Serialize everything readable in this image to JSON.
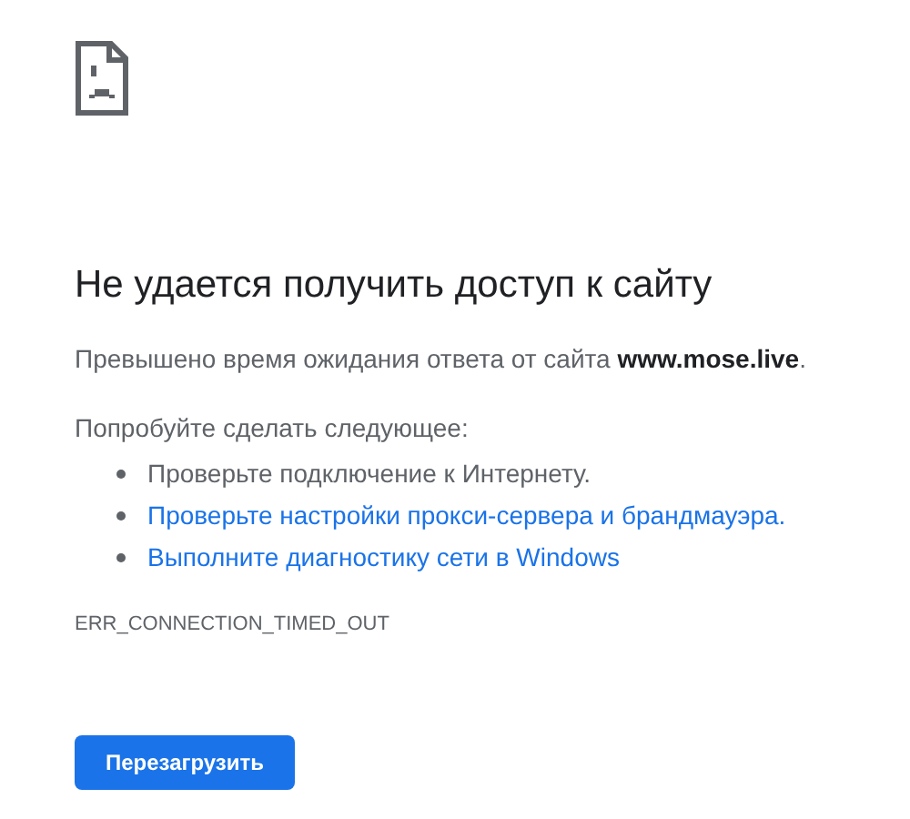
{
  "heading": "Не удается получить доступ к сайту",
  "description": "Превышено время ожидания ответа от сайта **www.mose.live**.",
  "suggestions_title": "Попробуйте сделать следующее:",
  "suggestions": [
    {
      "kind": "text",
      "label": "Проверьте подключение к Интернету."
    },
    {
      "kind": "link",
      "label": "Проверьте настройки прокси-сервера и брандмауэра."
    },
    {
      "kind": "link",
      "label": "Выполните диагностику сети в Windows"
    }
  ],
  "error_code": "ERR_CONNECTION_TIMED_OUT",
  "button": "Перезагрузить"
}
